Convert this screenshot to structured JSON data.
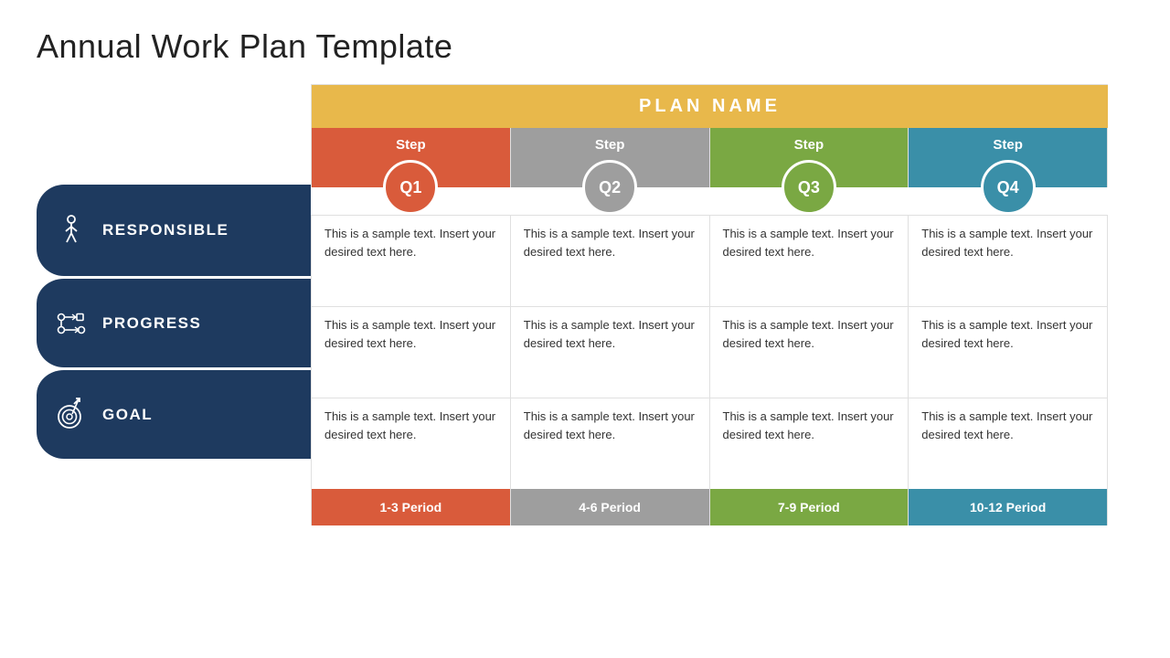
{
  "title": "Annual Work Plan Template",
  "plan_name": "PLAN NAME",
  "steps": [
    {
      "label": "Step",
      "quarter": "Q1",
      "colorClass": "step-bg-q1",
      "circleClass": "circle-q1"
    },
    {
      "label": "Step",
      "quarter": "Q2",
      "colorClass": "step-bg-q2",
      "circleClass": "circle-q2"
    },
    {
      "label": "Step",
      "quarter": "Q3",
      "colorClass": "step-bg-q3",
      "circleClass": "circle-q3"
    },
    {
      "label": "Step",
      "quarter": "Q4",
      "colorClass": "step-bg-q4",
      "circleClass": "circle-q4"
    }
  ],
  "rows": [
    {
      "id": "responsible",
      "label": "RESPONSIBLE",
      "cells": [
        "This is a sample text. Insert your desired text here.",
        "This is a sample text. Insert your desired text here.",
        "This is a sample text. Insert your desired text here.",
        "This is a sample text. Insert your desired text here."
      ]
    },
    {
      "id": "progress",
      "label": "PROGRESS",
      "cells": [
        "This is a sample text. Insert your desired text here.",
        "This is a sample text. Insert your desired text here.",
        "This is a sample text. Insert your desired text here.",
        "This is a sample text. Insert your desired text here."
      ]
    },
    {
      "id": "goal",
      "label": "GOAL",
      "cells": [
        "This is a sample text. Insert your desired text here.",
        "This is a sample text. Insert your desired text here.",
        "This is a sample text. Insert your desired text here.",
        "This is a sample text. Insert your desired text here."
      ]
    }
  ],
  "periods": [
    {
      "label": "1-3 Period",
      "colorClass": "period-q1"
    },
    {
      "label": "4-6 Period",
      "colorClass": "period-q2"
    },
    {
      "label": "7-9 Period",
      "colorClass": "period-q3"
    },
    {
      "label": "10-12 Period",
      "colorClass": "period-q4"
    }
  ]
}
